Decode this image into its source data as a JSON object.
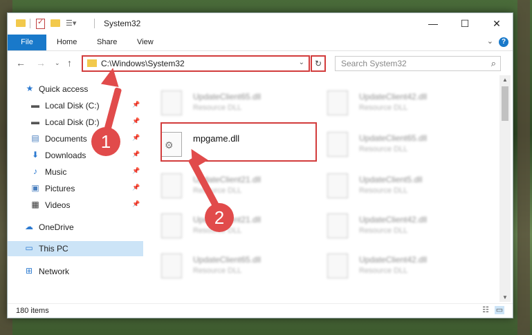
{
  "window": {
    "title": "System32",
    "minimize_glyph": "—",
    "maximize_glyph": "☐",
    "close_glyph": "✕"
  },
  "ribbon": {
    "tabs": [
      "File",
      "Home",
      "Share",
      "View"
    ],
    "help": "?"
  },
  "address": {
    "path": "C:\\Windows\\System32"
  },
  "search": {
    "placeholder": "Search System32"
  },
  "sidebar": {
    "items": [
      {
        "label": "Quick access",
        "icon": "star-icon"
      },
      {
        "label": "Local Disk (C:)",
        "icon": "drive-icon"
      },
      {
        "label": "Local Disk (D:)",
        "icon": "drive-icon"
      },
      {
        "label": "Documents",
        "icon": "documents-icon"
      },
      {
        "label": "Downloads",
        "icon": "download-icon"
      },
      {
        "label": "Music",
        "icon": "music-icon"
      },
      {
        "label": "Pictures",
        "icon": "pictures-icon"
      },
      {
        "label": "Videos",
        "icon": "videos-icon"
      },
      {
        "label": "OneDrive",
        "icon": "cloud-icon"
      },
      {
        "label": "This PC",
        "icon": "computer-icon"
      },
      {
        "label": "Network",
        "icon": "network-icon"
      }
    ]
  },
  "files": [
    {
      "name": "UpdateClient65.dll",
      "type": "Resource DLL"
    },
    {
      "name": "UpdateClient42.dll",
      "type": "Resource DLL"
    },
    {
      "name": "mpgame.dll",
      "type": ""
    },
    {
      "name": "UpdateClient65.dll",
      "type": "Resource DLL"
    },
    {
      "name": "UpdateClient21.dll",
      "type": "Resource DLL"
    },
    {
      "name": "UpdateClient5.dll",
      "type": "Resource DLL"
    },
    {
      "name": "UpdateClient21.dll",
      "type": "Resource DLL"
    },
    {
      "name": "UpdateClient42.dll",
      "type": "Resource DLL"
    },
    {
      "name": "UpdateClient65.dll",
      "type": "Resource DLL"
    },
    {
      "name": "UpdateClient42.dll",
      "type": "Resource DLL"
    }
  ],
  "status": {
    "item_count": "180 items"
  },
  "callouts": {
    "one": "1",
    "two": "2"
  },
  "colors": {
    "accent": "#1979ca",
    "highlight": "#d23b3b",
    "selection": "#cce4f7"
  }
}
